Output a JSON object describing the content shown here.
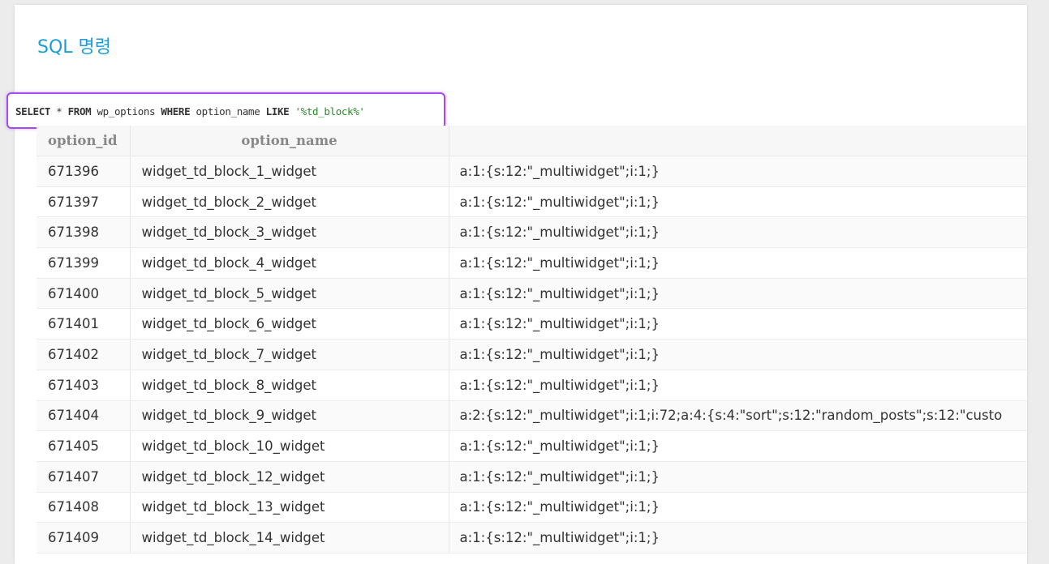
{
  "page": {
    "title": "SQL 명령"
  },
  "query": {
    "select": "SELECT",
    "star": " * ",
    "from": "FROM",
    "table": " wp_options ",
    "where": "WHERE",
    "column": " option_name ",
    "like": "LIKE",
    "pattern": " '%td_block%'"
  },
  "table": {
    "headers": [
      "option_id",
      "option_name",
      ""
    ],
    "rows": [
      [
        "671396",
        "widget_td_block_1_widget",
        "a:1:{s:12:\"_multiwidget\";i:1;}"
      ],
      [
        "671397",
        "widget_td_block_2_widget",
        "a:1:{s:12:\"_multiwidget\";i:1;}"
      ],
      [
        "671398",
        "widget_td_block_3_widget",
        "a:1:{s:12:\"_multiwidget\";i:1;}"
      ],
      [
        "671399",
        "widget_td_block_4_widget",
        "a:1:{s:12:\"_multiwidget\";i:1;}"
      ],
      [
        "671400",
        "widget_td_block_5_widget",
        "a:1:{s:12:\"_multiwidget\";i:1;}"
      ],
      [
        "671401",
        "widget_td_block_6_widget",
        "a:1:{s:12:\"_multiwidget\";i:1;}"
      ],
      [
        "671402",
        "widget_td_block_7_widget",
        "a:1:{s:12:\"_multiwidget\";i:1;}"
      ],
      [
        "671403",
        "widget_td_block_8_widget",
        "a:1:{s:12:\"_multiwidget\";i:1;}"
      ],
      [
        "671404",
        "widget_td_block_9_widget",
        "a:2:{s:12:\"_multiwidget\";i:1;i:72;a:4:{s:4:\"sort\";s:12:\"random_posts\";s:12:\"custo"
      ],
      [
        "671405",
        "widget_td_block_10_widget",
        "a:1:{s:12:\"_multiwidget\";i:1;}"
      ],
      [
        "671407",
        "widget_td_block_12_widget",
        "a:1:{s:12:\"_multiwidget\";i:1;}"
      ],
      [
        "671408",
        "widget_td_block_13_widget",
        "a:1:{s:12:\"_multiwidget\";i:1;}"
      ],
      [
        "671409",
        "widget_td_block_14_widget",
        "a:1:{s:12:\"_multiwidget\";i:1;}"
      ]
    ]
  },
  "colors": {
    "title": "#1a9ed8",
    "highlight_border": "#a24cf0",
    "string_literal": "#2a8a2a"
  }
}
